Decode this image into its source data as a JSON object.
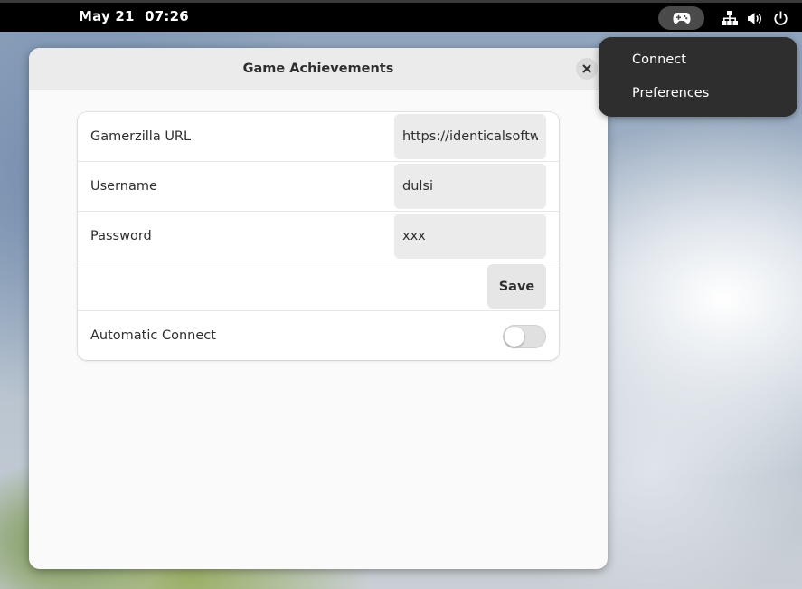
{
  "topbar": {
    "date": "May 21",
    "time": "07:26",
    "icons": [
      "gamepad-icon",
      "network-wired-icon",
      "volume-icon",
      "power-icon"
    ]
  },
  "popup_menu": {
    "items": [
      {
        "label": "Connect"
      },
      {
        "label": "Preferences"
      }
    ]
  },
  "window": {
    "title": "Game Achievements",
    "close_icon": "close-icon",
    "rows": {
      "url": {
        "label": "Gamerzilla URL",
        "value": "https://identicalsoftwar"
      },
      "username": {
        "label": "Username",
        "value": "dulsi"
      },
      "password": {
        "label": "Password",
        "value": "xxx"
      },
      "save": {
        "label": "Save"
      },
      "auto_connect": {
        "label": "Automatic Connect",
        "enabled": false
      }
    }
  },
  "colors": {
    "topbar_bg": "#000000",
    "popup_bg": "#2e2e2e",
    "window_bg": "#fafafa",
    "headerbar_bg": "#ebebeb",
    "entry_bg": "#ebebeb"
  }
}
